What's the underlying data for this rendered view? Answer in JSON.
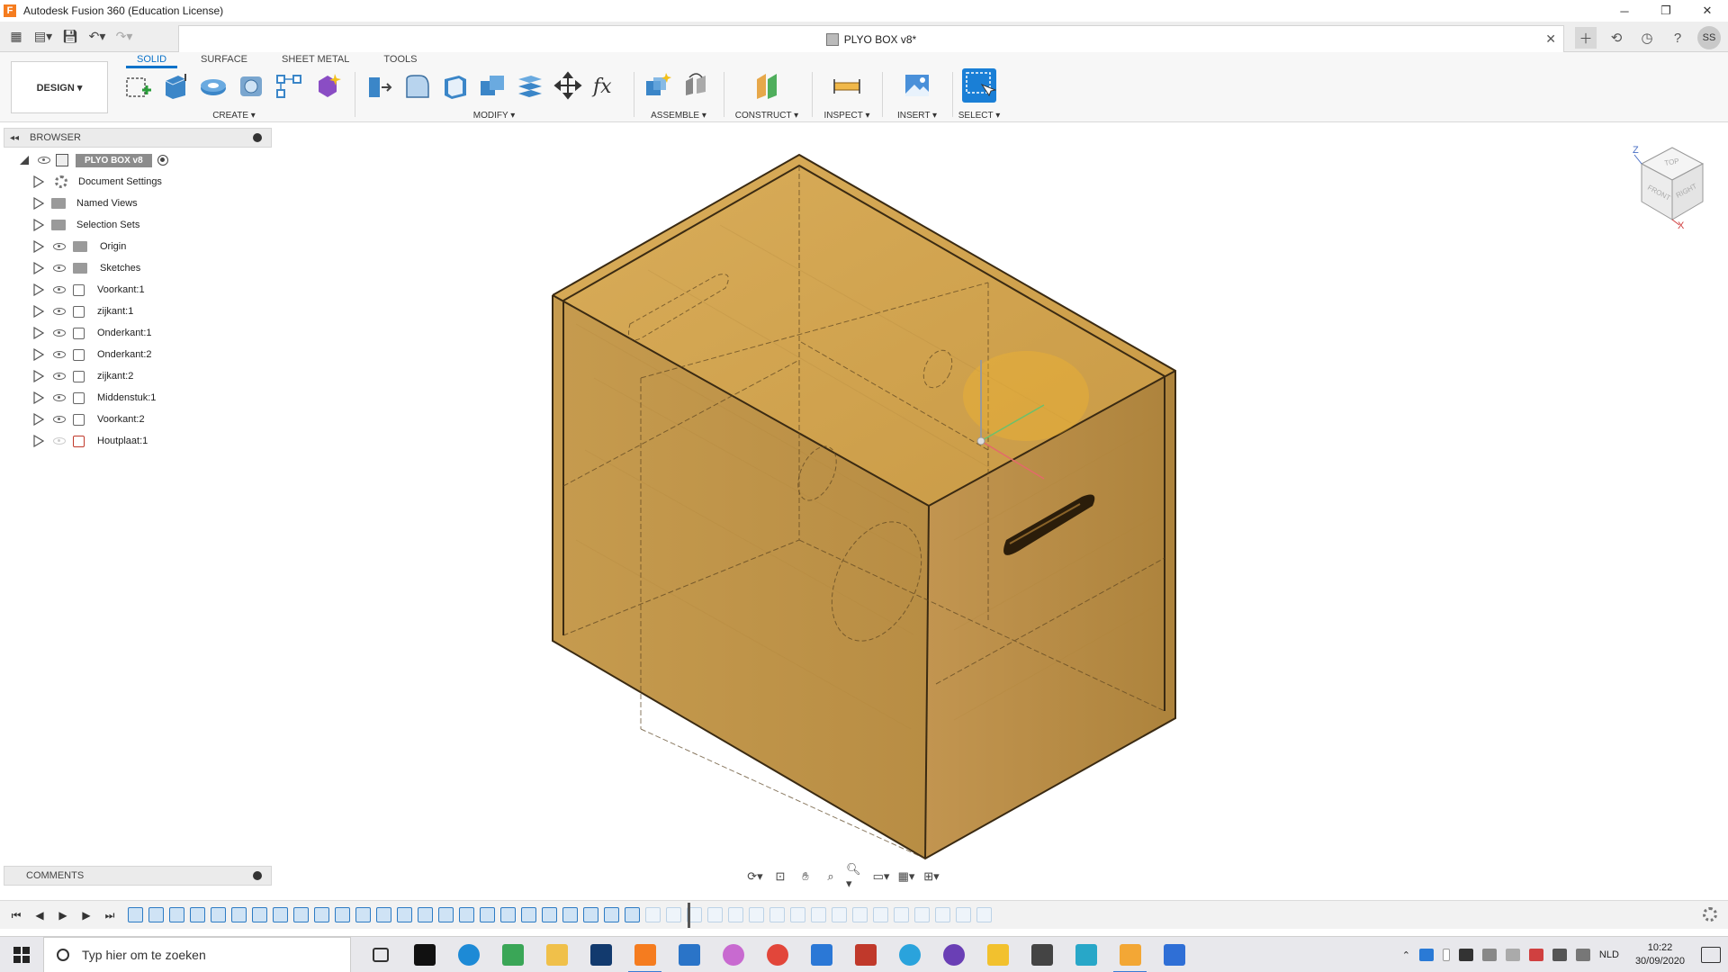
{
  "window": {
    "app_letter": "F",
    "title": "Autodesk Fusion 360 (Education License)",
    "minimize": "─",
    "restore": "❐",
    "close": "✕"
  },
  "tabbar": {
    "doc_title": "PLYO BOX v8*",
    "doc_close": "✕",
    "user_initials": "SS"
  },
  "ribbon": {
    "workspace": "DESIGN ▾",
    "tabs": [
      "SOLID",
      "SURFACE",
      "SHEET METAL",
      "TOOLS"
    ],
    "groups": {
      "create": "CREATE ▾",
      "modify": "MODIFY ▾",
      "assemble": "ASSEMBLE ▾",
      "construct": "CONSTRUCT ▾",
      "inspect": "INSPECT ▾",
      "insert": "INSERT ▾",
      "select": "SELECT ▾"
    },
    "modify_fx": "fx"
  },
  "browser": {
    "header": "BROWSER",
    "root": "PLYO BOX v8",
    "items": [
      {
        "label": "Document Settings"
      },
      {
        "label": "Named Views"
      },
      {
        "label": "Selection Sets"
      },
      {
        "label": "Origin"
      },
      {
        "label": "Sketches"
      },
      {
        "label": "Voorkant:1"
      },
      {
        "label": "zijkant:1"
      },
      {
        "label": "Onderkant:1"
      },
      {
        "label": "Onderkant:2"
      },
      {
        "label": "zijkant:2"
      },
      {
        "label": "Middenstuk:1"
      },
      {
        "label": "Voorkant:2"
      },
      {
        "label": "Houtplaat:1"
      }
    ]
  },
  "viewcube": {
    "top": "TOP",
    "front": "FRONT",
    "right": "RIGHT",
    "axis_z": "Z",
    "axis_x": "X"
  },
  "comments": {
    "header": "COMMENTS"
  },
  "taskbar": {
    "search_placeholder": "Typ hier om te zoeken",
    "language": "NLD",
    "time": "10:22",
    "date": "30/09/2020"
  },
  "colors": {
    "accent": "#0a72c9",
    "wood_top": "#d8a94e",
    "wood_front": "#caa050",
    "wood_side": "#b98d3f"
  }
}
